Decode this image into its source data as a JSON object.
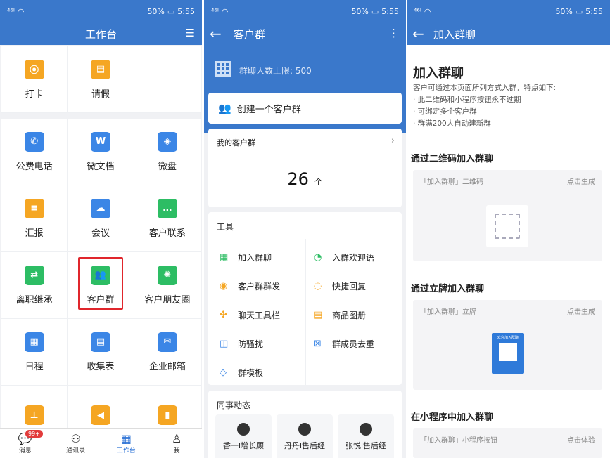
{
  "status": {
    "time": "5:55",
    "battery": "50%",
    "signal": "⁴⁶ᴵ"
  },
  "panel1": {
    "title": "工作台",
    "top_row": [
      {
        "label": "打卡",
        "icon": "location-icon",
        "color": "#f5a623"
      },
      {
        "label": "请假",
        "icon": "calendar-icon",
        "color": "#f5a623"
      }
    ],
    "apps": [
      {
        "label": "公费电话",
        "icon": "phone-icon",
        "color": "#3b86e6",
        "glyph": "✆"
      },
      {
        "label": "微文档",
        "icon": "doc-w-icon",
        "color": "#3b86e6",
        "glyph": "W"
      },
      {
        "label": "微盘",
        "icon": "drive-icon",
        "color": "#3b86e6",
        "glyph": "◈"
      },
      {
        "label": "汇报",
        "icon": "report-icon",
        "color": "#f5a623",
        "glyph": "≡"
      },
      {
        "label": "会议",
        "icon": "meeting-icon",
        "color": "#3b86e6",
        "glyph": "☁"
      },
      {
        "label": "客户联系",
        "icon": "chat-icon",
        "color": "#2dbd64",
        "glyph": "…"
      },
      {
        "label": "离职继承",
        "icon": "transfer-icon",
        "color": "#2dbd64",
        "glyph": "⇄"
      },
      {
        "label": "客户群",
        "icon": "group-icon",
        "color": "#2dbd64",
        "glyph": "👥"
      },
      {
        "label": "客户朋友圈",
        "icon": "moments-icon",
        "color": "#2dbd64",
        "glyph": "✺"
      },
      {
        "label": "日程",
        "icon": "schedule-icon",
        "color": "#3b86e6",
        "glyph": "▦"
      },
      {
        "label": "收集表",
        "icon": "form-icon",
        "color": "#3b86e6",
        "glyph": "▤"
      },
      {
        "label": "企业邮箱",
        "icon": "mail-icon",
        "color": "#3b86e6",
        "glyph": "✉"
      },
      {
        "label": "",
        "icon": "stamp-icon",
        "color": "#f5a623",
        "glyph": "⊥"
      },
      {
        "label": "",
        "icon": "megaphone-icon",
        "color": "#f5a623",
        "glyph": "◀"
      },
      {
        "label": "",
        "icon": "door-icon",
        "color": "#f5a623",
        "glyph": "▮"
      }
    ],
    "tabs": [
      {
        "label": "消息",
        "badge": "99+"
      },
      {
        "label": "通讯录"
      },
      {
        "label": "工作台"
      },
      {
        "label": "我"
      }
    ]
  },
  "panel2": {
    "title": "客户群",
    "limit_text": "群聊人数上限: 500",
    "create_label": "创建一个客户群",
    "my_groups_label": "我的客户群",
    "count": "26",
    "count_unit": "个",
    "tools_label": "工具",
    "tools": [
      {
        "label": "加入群聊",
        "icon": "qr-icon",
        "glyph": "▦"
      },
      {
        "label": "入群欢迎语",
        "icon": "welcome-icon",
        "glyph": "◔"
      },
      {
        "label": "客户群群发",
        "icon": "broadcast-icon",
        "glyph": "◉"
      },
      {
        "label": "快捷回复",
        "icon": "reply-icon",
        "glyph": "◌"
      },
      {
        "label": "聊天工具栏",
        "icon": "toolbar-icon",
        "glyph": "✣"
      },
      {
        "label": "商品图册",
        "icon": "catalog-icon",
        "glyph": "▤"
      },
      {
        "label": "防骚扰",
        "icon": "shield-icon",
        "glyph": "◫"
      },
      {
        "label": "群成员去重",
        "icon": "dedupe-icon",
        "glyph": "⊠"
      },
      {
        "label": "群模板",
        "icon": "template-icon",
        "glyph": "◇"
      }
    ],
    "feed_label": "同事动态",
    "feed": [
      "香一l增长顾",
      "丹丹l售后经",
      "张悦l售后经"
    ]
  },
  "panel3": {
    "title": "加入群聊",
    "page_title": "加入群聊",
    "desc": "客户可通过本页面所列方式入群，特点如下:",
    "bullets": [
      "· 此二维码和小程序按钮永不过期",
      "· 可绑定多个客户群",
      "· 群满200人自动建新群"
    ],
    "sections": [
      {
        "heading": "通过二维码加入群聊",
        "item": "「加入群聊」二维码",
        "action": "点击生成"
      },
      {
        "heading": "通过立牌加入群聊",
        "item": "「加入群聊」立牌",
        "action": "点击生成"
      },
      {
        "heading": "在小程序中加入群聊",
        "item": "「加入群聊」小程序按钮",
        "action": "点击体验"
      }
    ],
    "stand_caption": "欢迎加入群聊"
  }
}
